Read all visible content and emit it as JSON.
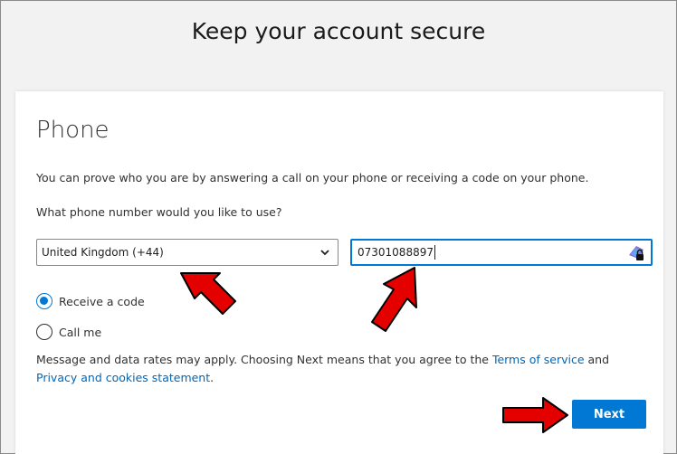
{
  "header": {
    "title": "Keep your account secure"
  },
  "card": {
    "section_title": "Phone",
    "description": "You can prove who you are by answering a call on your phone or receiving a code on your phone.",
    "question": "What phone number would you like to use?",
    "country_select": {
      "selected": "United Kingdom (+44)"
    },
    "phone_input": {
      "value": "07301088897"
    },
    "options": [
      {
        "label": "Receive a code",
        "checked": true
      },
      {
        "label": "Call me",
        "checked": false
      }
    ],
    "notice": {
      "text_before": "Message and data rates may apply. Choosing Next means that you agree to the ",
      "terms_link": "Terms of service",
      "and_text": " and ",
      "privacy_link": "Privacy and cookies statement",
      "end_text": "."
    },
    "next_label": "Next"
  },
  "colors": {
    "accent": "#0078d4",
    "link": "#0067b8",
    "annotation_arrow": "#e00000"
  },
  "icons": [
    "chevron-down-icon",
    "password-manager-lock-icon",
    "red-arrow-annotation"
  ]
}
